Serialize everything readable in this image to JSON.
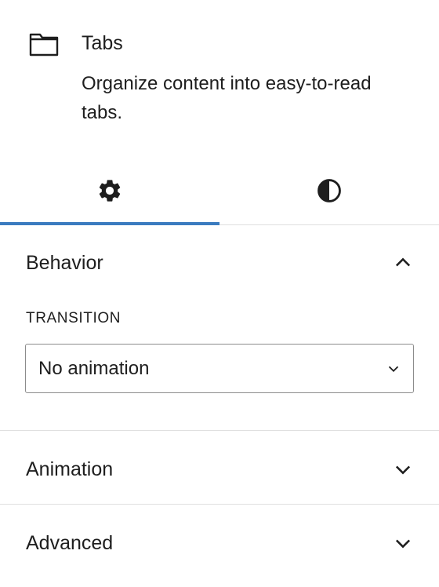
{
  "block": {
    "icon": "folder-icon",
    "title": "Tabs",
    "description": "Organize content into easy-to-read tabs."
  },
  "tabs": [
    {
      "icon": "gear-icon",
      "active": true
    },
    {
      "icon": "contrast-icon",
      "active": false
    }
  ],
  "sections": {
    "behavior": {
      "title": "Behavior",
      "expanded": true,
      "transition_label": "TRANSITION",
      "transition_value": "No animation"
    },
    "animation": {
      "title": "Animation",
      "expanded": false
    },
    "advanced": {
      "title": "Advanced",
      "expanded": false
    }
  },
  "colors": {
    "accent": "#3a7bbf",
    "text": "#1e1e1e",
    "divider": "#e0e0e0"
  }
}
